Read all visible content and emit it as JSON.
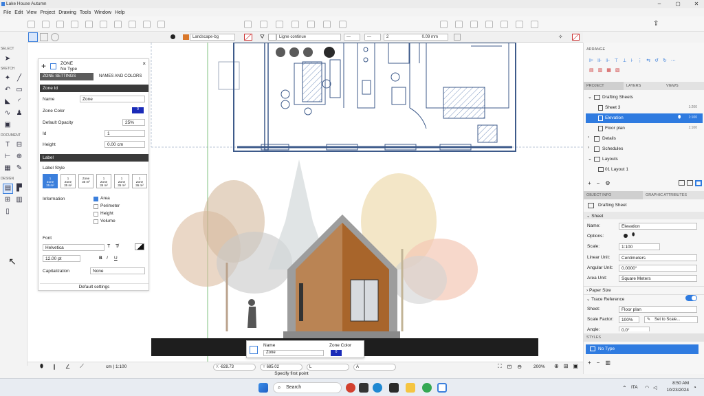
{
  "window": {
    "title": "Lake House Autumn",
    "minimize": "–",
    "maximize": "▢",
    "close": "✕"
  },
  "menu": [
    "File",
    "Edit",
    "View",
    "Project",
    "Drawing",
    "Tools",
    "Window",
    "Help"
  ],
  "toolbar2": {
    "layer": "Landscape-bg",
    "line_style": "Ligne continue",
    "line_count": "2",
    "line_width": "0.09 mm"
  },
  "left_sections": {
    "select": "SELECT",
    "sketch": "SKETCH",
    "document": "DOCUMENT",
    "design": "DESIGN"
  },
  "zone_panel": {
    "title": "ZONE",
    "subtitle": "No Type",
    "tab_settings": "ZONE SETTINGS",
    "tab_names": "NAMES AND COLORS",
    "sec_zone_id": "Zone Id",
    "name_label": "Name",
    "name_value": "Zone",
    "color_label": "Zone Color",
    "color_value": "0",
    "opacity_label": "Default Opacity",
    "opacity_value": "25%",
    "id_label": "Id",
    "id_value": "1",
    "height_label": "Height",
    "height_value": "0.00 cm",
    "sec_label": "Label",
    "label_style": "Label Style",
    "styles": [
      {
        "l1": "1",
        "l2": "Zone",
        "l3": "35 m²"
      },
      {
        "l1": "1",
        "l2": "Zone",
        "l3": "35 m²"
      },
      {
        "l1": "",
        "l2": "Zone",
        "l3": "35 m²"
      },
      {
        "l1": "1",
        "l2": "Zone",
        "l3": "35 m²"
      },
      {
        "l1": "1",
        "l2": "Zone",
        "l3": "35 m²"
      },
      {
        "l1": "1",
        "l2": "Zone",
        "l3": "36 m²"
      }
    ],
    "information_label": "Information",
    "info_items": [
      {
        "label": "Area",
        "checked": true
      },
      {
        "label": "Perimeter",
        "checked": false
      },
      {
        "label": "Height",
        "checked": false
      },
      {
        "label": "Volume",
        "checked": false
      }
    ],
    "font_label": "Font",
    "font_value": "Helvetica",
    "size_value": "12.00 pt",
    "capitalization_label": "Capitalization",
    "capitalization_value": "None",
    "default_settings": "Default settings"
  },
  "right_panel": {
    "arrange": "ARRANGE",
    "tabs": [
      "PROJECT",
      "LAYERS",
      "VIEWS"
    ],
    "tree_root": "Drafting Sheets",
    "sheets": [
      {
        "label": "Sheet 3",
        "scale": "1:200"
      },
      {
        "label": "Elevation",
        "scale": "1:100"
      },
      {
        "label": "Floor plan",
        "scale": "1:100"
      }
    ],
    "folders": [
      "Details",
      "Schedules",
      "Layouts"
    ],
    "layout_item": "01 Layout 1",
    "info_tabs": [
      "OBJECT INFO",
      "GRAPHIC ATTRIBUTES"
    ],
    "object_type": "Drafting Sheet",
    "sheet_section": "Sheet",
    "props": {
      "name_label": "Name:",
      "name_value": "Elevation",
      "options_label": "Options:",
      "scale_label": "Scale:",
      "scale_value": "1:100",
      "linear_label": "Linear Unit:",
      "linear_value": "Centimeters",
      "angular_label": "Angular Unit:",
      "angular_value": "0.0000°",
      "area_label": "Area Unit:",
      "area_value": "Square Meters"
    },
    "paper_size": "Paper Size",
    "trace_reference": "Trace Reference",
    "trace": {
      "sheet_label": "Sheet:",
      "sheet_value": "Floor plan",
      "factor_label": "Scale Factor:",
      "factor_value": "100%",
      "set_scale": "Set to Scale...",
      "angle_label": "Angle:",
      "angle_value": "0.0°"
    },
    "styles_head": "STYLES",
    "style_item": "No Type"
  },
  "zone_popup": {
    "name_label": "Name",
    "name_value": "Zone",
    "color_label": "Zone Color",
    "color_value": "0"
  },
  "status": {
    "units": "cm | 1:100",
    "x": "-828.73",
    "y": "685.02",
    "l": "L",
    "a": "A",
    "zoom": "200%",
    "hint": "Specify first point"
  },
  "taskbar": {
    "search": "Search",
    "lang": "ITA",
    "time": "8:50 AM",
    "date": "10/23/2024"
  }
}
